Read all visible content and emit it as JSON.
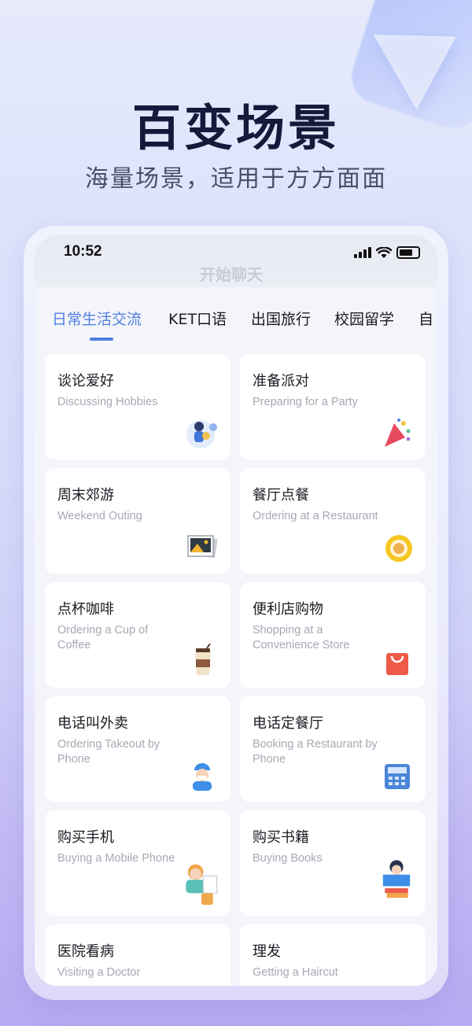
{
  "hero": {
    "title": "百变场景",
    "subtitle": "海量场景，适用于方方面面"
  },
  "status_bar": {
    "time": "10:52"
  },
  "header_ghost": "开始聊天",
  "tabs": [
    {
      "label": "日常生活交流",
      "active": true
    },
    {
      "label": "KET口语"
    },
    {
      "label": "出国旅行"
    },
    {
      "label": "校园留学"
    },
    {
      "label": "自"
    }
  ],
  "scenes": [
    {
      "cn": "谈论爱好",
      "en": "Discussing Hobbies",
      "icon": "hobbies-icon"
    },
    {
      "cn": "准备派对",
      "en": "Preparing for a Party",
      "icon": "party-icon"
    },
    {
      "cn": "周末郊游",
      "en": "Weekend Outing",
      "icon": "photo-icon"
    },
    {
      "cn": "餐厅点餐",
      "en": "Ordering at a Restaurant",
      "icon": "plate-icon"
    },
    {
      "cn": "点杯咖啡",
      "en": "Ordering a Cup of Coffee",
      "icon": "coffee-icon"
    },
    {
      "cn": "便利店购物",
      "en": "Shopping at a Convenience Store",
      "icon": "shopping-bag-icon"
    },
    {
      "cn": "电话叫外卖",
      "en": "Ordering Takeout by Phone",
      "icon": "delivery-icon"
    },
    {
      "cn": "电话定餐厅",
      "en": "Booking a Restaurant by Phone",
      "icon": "telephone-icon"
    },
    {
      "cn": "购买手机",
      "en": "Buying a Mobile Phone",
      "icon": "mobile-phone-icon"
    },
    {
      "cn": "购买书籍",
      "en": "Buying Books",
      "icon": "books-icon"
    },
    {
      "cn": "医院看病",
      "en": "Visiting a Doctor",
      "icon": "doctor-icon"
    },
    {
      "cn": "理发",
      "en": "Getting a Haircut",
      "icon": "haircut-icon"
    }
  ],
  "colors": {
    "accent": "#4f7fe0",
    "card": "#ffffff",
    "title": "#141a3a"
  }
}
